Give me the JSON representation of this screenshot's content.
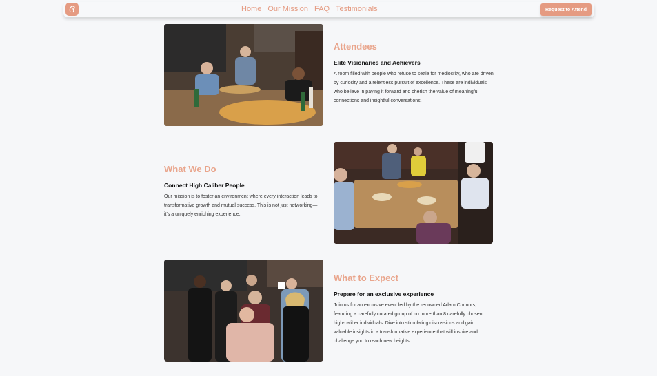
{
  "brand": {
    "logo_icon": "horse-head-logo-icon",
    "accent": "#e59b82",
    "title_color": "#e9a58c"
  },
  "nav": {
    "links": [
      {
        "label": "Home"
      },
      {
        "label": "Our Mission"
      },
      {
        "label": "FAQ"
      },
      {
        "label": "Testimonials"
      }
    ],
    "cta_label": "Request to Attend"
  },
  "sections": [
    {
      "title": "Attendees",
      "subtitle": "Elite Visionaries and Achievers",
      "body": "A room filled with people who refuse to settle for mediocrity, who are driven by curiosity and a relentless pursuit of excellence. These are individuals who believe in paying it forward and cherish the value of meaningful connections and insightful conversations.",
      "image_icon": "group-dinner-photo"
    },
    {
      "title": "What We Do",
      "subtitle": "Connect High Caliber People",
      "body": "Our mission is to foster an environment where every interaction leads to transformative growth and mutual success. This is not just networking—it's a uniquely enriching experience.",
      "image_icon": "roundtable-discussion-photo"
    },
    {
      "title": "What to Expect",
      "subtitle": "Prepare for an exclusive experience",
      "body": "Join us for an exclusive event led by the renowned Adam Connors, featuring a carefully curated group of no more than 8 carefully chosen, high-caliber individuals. Dive into stimulating discussions and gain valuable insights in a transformative experience that will inspire and challenge you to reach new heights.",
      "image_icon": "group-portrait-photo"
    }
  ]
}
